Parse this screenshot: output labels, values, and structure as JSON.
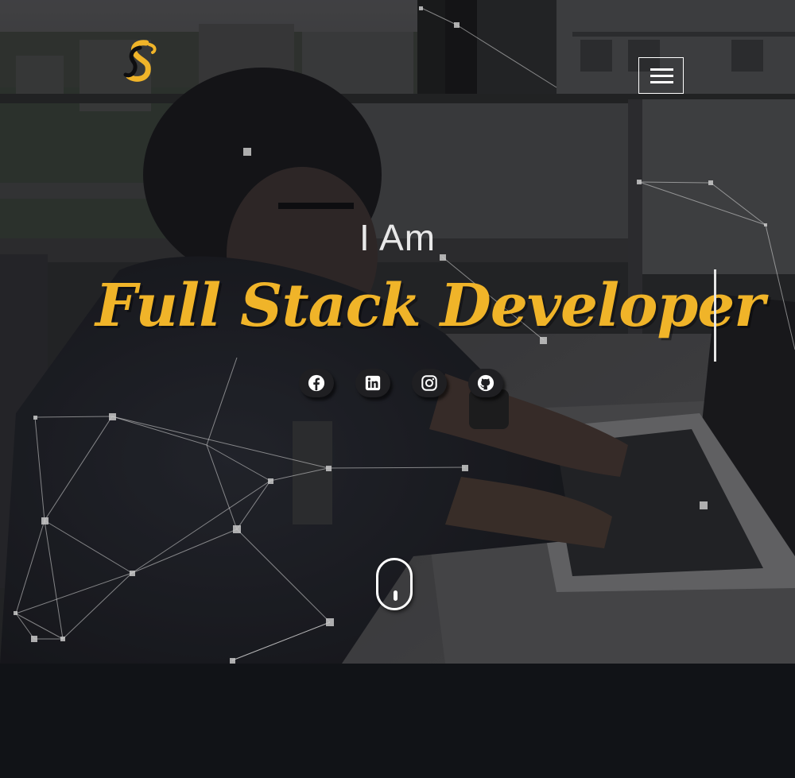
{
  "hero": {
    "intro": "I Am",
    "title": "Full Stack Developer"
  },
  "logo": {
    "icon": "s-monogram-logo"
  },
  "menu": {
    "icon": "hamburger-icon"
  },
  "socials": [
    {
      "name": "facebook",
      "icon": "facebook-icon"
    },
    {
      "name": "linkedin",
      "icon": "linkedin-icon"
    },
    {
      "name": "instagram",
      "icon": "instagram-icon"
    },
    {
      "name": "github",
      "icon": "github-icon"
    }
  ],
  "scroll": {
    "icon": "mouse-scroll-icon"
  },
  "colors": {
    "accent": "#f0b429",
    "text": "#ffffff",
    "background": "#111317"
  }
}
